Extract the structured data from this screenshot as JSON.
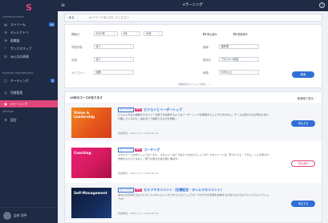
{
  "sidebar": {
    "logo": "S",
    "section_community": "Communication",
    "items": [
      {
        "label": "ストリーム",
        "icon": "stream-icon",
        "badge": "12"
      },
      {
        "label": "ディレクトリ",
        "icon": "directory-icon"
      },
      {
        "label": "組織図",
        "icon": "org-chart-icon"
      },
      {
        "label": "サンクスマップ",
        "icon": "thanks-map-icon"
      },
      {
        "label": "みんなの表情",
        "icon": "faces-icon"
      }
    ],
    "section_business": "Business Management",
    "business_items": [
      {
        "label": "ミーティング",
        "icon": "meeting-icon",
        "badge": "2"
      },
      {
        "label": "目標管理",
        "icon": "goal-icon"
      },
      {
        "label": "eラーニング",
        "icon": "elearning-icon",
        "active": true
      }
    ],
    "section_settings": "Settings",
    "settings_items": [
      {
        "label": "設定",
        "icon": "settings-icon"
      }
    ],
    "user_name": "吉村 洋平"
  },
  "topbar": {
    "title": "eラーニング",
    "help": "?"
  },
  "search": {
    "back_label": "‹ 戻る",
    "placeholder": "キーワードを入力してください"
  },
  "filters": {
    "period_label": "開催日",
    "year_value": "2021年",
    "month_value": "9月",
    "day_value": "18日",
    "check_applied": "申込済み",
    "check_viewed": "受講済み",
    "format_label": "学習形態",
    "format_value": "全て",
    "language_label": "言語",
    "language_value": "全て",
    "category_label": "カテゴリー",
    "category_value": "全般",
    "lecturer_label": "講師",
    "lecturer_value": "選択済",
    "provider_label": "提供元",
    "provider_value": "プロスキル認定",
    "duration_label": "時間",
    "duration_value": "30分以上",
    "search_button": "検索",
    "more_label": "詳細検索オプションを開く ⌄"
  },
  "results": {
    "count_label": "10件のコースがあります",
    "sort_label": "新着順で表示",
    "courses": [
      {
        "thumb_text": "Vision & Leadership",
        "category": "eラーニング",
        "new": "NEW",
        "title": "ビジョンとリーダーシップ",
        "desc": "ビジョンのない組織やマネジャーは部下を指導するようなリーダーシップを発揮することができません。チームは自分たちが何のために行動しているのか、会社がどう貢献できるかを見極…",
        "period": "受講期間：2021.4.5 〜 2022.02.14",
        "button": "申込する"
      },
      {
        "thumb_text": "Coaching",
        "category": "eラーニング",
        "new": "NEW",
        "title": "コーチング",
        "desc": "マネジャーとは何でしょうか？また、マネジャーはどうあるべきなのでしょうか？マネジャーとは「気づいてる・できる」ことを見つけ支援するだけではなく、部下の能力を最大限に伸ばせ…",
        "period": "受講期間：2021.4.5 〜 2022.02.14",
        "button": "申込済み"
      },
      {
        "thumb_text": "Self-Management",
        "category": "eラーニング",
        "new": "NEW",
        "title": "セルフマネジメント（目標設定・タイムマネジメント）",
        "desc": "あなたは日頃どのようにタイムマネジメントができているでしょうか？それぞれの目標を達成するためにはどのようにしたらいいでしょうか？",
        "period": "受講期間：2021.4.5 〜 2022.02.14",
        "button": "申込する"
      }
    ]
  },
  "colors": {
    "sidebar_bg": "#1f2a44",
    "accent_pink": "#e0457b",
    "primary_blue": "#2f6fd6"
  }
}
